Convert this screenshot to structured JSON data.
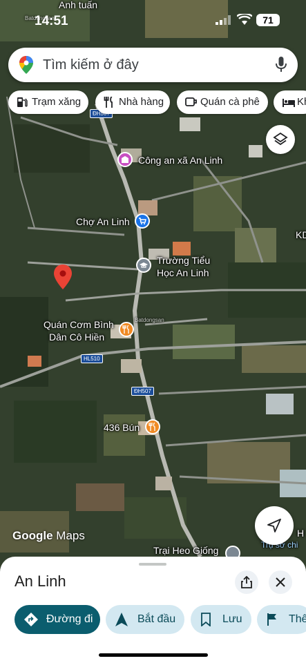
{
  "status_bar": {
    "time": "14:51",
    "battery": "71"
  },
  "search": {
    "placeholder": "Tìm kiếm ở đây"
  },
  "chips": [
    {
      "label": "Trạm xăng",
      "icon": "gas-station-icon"
    },
    {
      "label": "Nhà hàng",
      "icon": "restaurant-icon"
    },
    {
      "label": "Quán cà phê",
      "icon": "coffee-icon"
    },
    {
      "label": "Kh",
      "icon": "hotel-bed-icon"
    }
  ],
  "map": {
    "labels": {
      "top": "Anh tuấn",
      "police": "Công an xã An Linh",
      "market": "Chợ An Linh",
      "school_line1": "Trường Tiểu",
      "school_line2": "Học An Linh",
      "restaurant_line1": "Quán Cơm Bình",
      "restaurant_line2": "Dân Cô Hiền",
      "bun": "436 Bún",
      "farm": "Trại Heo Giống",
      "kd": "KD",
      "right_edge": "H",
      "right_edge2": "Trụ sở chi",
      "watermark": "Batdongsan"
    },
    "road_tags": {
      "dh507_top": "ĐH507",
      "hl510": "HL510",
      "dh507": "ĐH507"
    },
    "colors": {
      "pin": "#ea4335",
      "poi_pink": "#c84fc2",
      "poi_blue": "#1a73e8",
      "poi_gray": "#7b8792",
      "poi_orange": "#f08a24"
    }
  },
  "attribution": {
    "google": "Google",
    "maps": "Maps"
  },
  "sheet": {
    "place_name": "An Linh",
    "actions": [
      {
        "label": "Đường đi",
        "icon": "directions-icon"
      },
      {
        "label": "Bắt đầu",
        "icon": "navigation-arrow-icon"
      },
      {
        "label": "Lưu",
        "icon": "bookmark-icon"
      },
      {
        "label": "Thê",
        "icon": "flag-icon"
      }
    ]
  }
}
